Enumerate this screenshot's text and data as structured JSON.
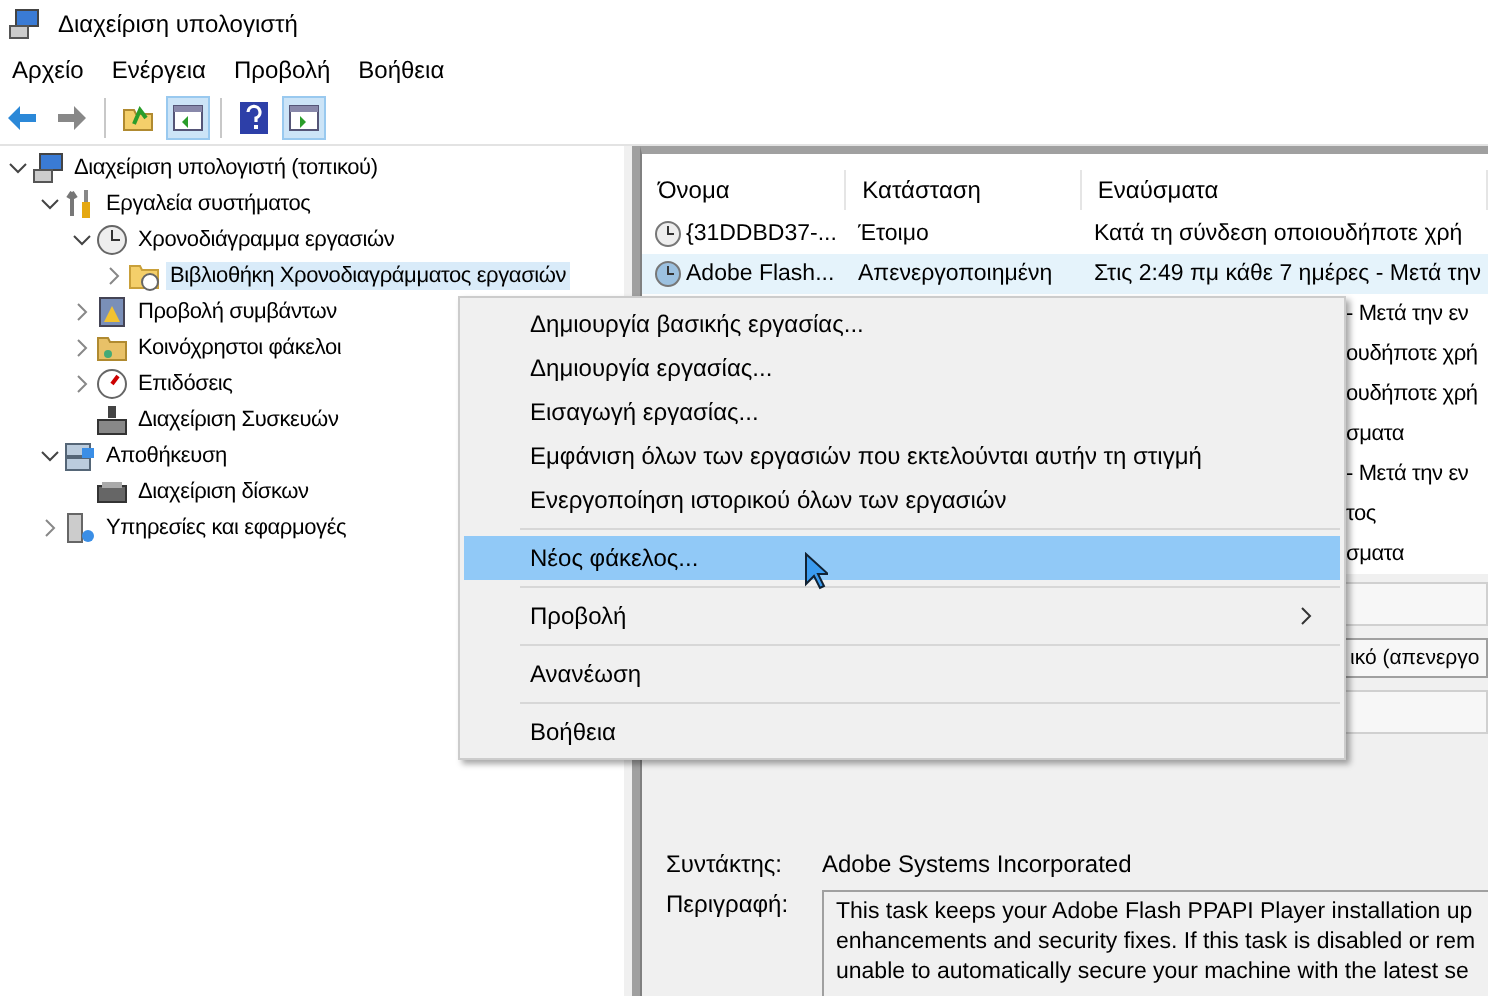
{
  "window": {
    "title": "Διαχείριση υπολογιστή"
  },
  "menu_bar": [
    "Αρχείο",
    "Ενέργεια",
    "Προβολή",
    "Βοήθεια"
  ],
  "toolbar": [
    {
      "kind": "back",
      "pressed": false
    },
    {
      "kind": "forward",
      "pressed": false
    },
    {
      "kind": "separator"
    },
    {
      "kind": "up",
      "pressed": false
    },
    {
      "kind": "tree",
      "pressed": true
    },
    {
      "kind": "separator"
    },
    {
      "kind": "help",
      "pressed": false
    },
    {
      "kind": "pane",
      "pressed": true
    }
  ],
  "tree": [
    {
      "label": "Διαχείριση υπολογιστή (τοπικού)",
      "kind": "computer",
      "expanded": true,
      "selected": false,
      "children": [
        {
          "label": "Εργαλεία συστήματος",
          "kind": "tools",
          "expanded": true,
          "selected": false,
          "children": [
            {
              "label": "Χρονοδιάγραμμα εργασιών",
              "kind": "clock",
              "expanded": true,
              "selected": false,
              "children": [
                {
                  "label": "Βιβλιοθήκη Χρονοδιαγράμματος εργασιών",
                  "kind": "folder",
                  "expanded": false,
                  "selected": true
                }
              ]
            },
            {
              "label": "Προβολή συμβάντων",
              "kind": "log",
              "expanded": false,
              "selected": false
            },
            {
              "label": "Κοινόχρηστοι φάκελοι",
              "kind": "share",
              "expanded": false,
              "selected": false
            },
            {
              "label": "Επιδόσεις",
              "kind": "gauge",
              "expanded": false,
              "selected": false
            },
            {
              "label": "Διαχείριση Συσκευών",
              "kind": "device",
              "selected": false
            }
          ]
        },
        {
          "label": "Αποθήκευση",
          "kind": "storage",
          "expanded": true,
          "selected": false,
          "children": [
            {
              "label": "Διαχείριση δίσκων",
              "kind": "disk",
              "selected": false
            }
          ]
        },
        {
          "label": "Υπηρεσίες και εφαρμογές",
          "kind": "services",
          "expanded": false,
          "selected": false
        }
      ]
    }
  ],
  "table": {
    "columns": [
      "Όνομα",
      "Κατάσταση",
      "Εναύσματα"
    ],
    "rows": [
      {
        "kind": "full",
        "cells": [
          "{31DDBD37-...",
          "Έτοιμο",
          "Κατά τη σύνδεση οποιουδήποτε χρή"
        ],
        "selected": false
      },
      {
        "kind": "full",
        "cells": [
          "Adobe Flash...",
          "Απενεργοποιημένη",
          "Στις 2:49 πμ κάθε 7 ημέρες - Μετά την"
        ],
        "selected": true
      },
      {
        "kind": "partial",
        "cells": [
          "- Μετά την εν"
        ],
        "selected": false
      },
      {
        "kind": "partial",
        "cells": [
          "ουδήποτε χρή"
        ],
        "selected": false
      },
      {
        "kind": "partial",
        "cells": [
          "ουδήποτε χρή"
        ],
        "selected": false
      },
      {
        "kind": "partial",
        "cells": [
          "σματα"
        ],
        "selected": false
      },
      {
        "kind": "partial",
        "cells": [
          "- Μετά την εν"
        ],
        "selected": false
      },
      {
        "kind": "partial",
        "cells": [
          "τος"
        ],
        "selected": false
      },
      {
        "kind": "partial",
        "cells": [
          "σματα"
        ],
        "selected": false
      }
    ]
  },
  "details": {
    "field_value": "ικό (απενεργο",
    "author_label": "Συντάκτης:",
    "author": "Adobe Systems Incorporated",
    "description_label": "Περιγραφή:",
    "description": "This task keeps your Adobe Flash PPAPI Player installation up\nenhancements and security fixes. If this task is disabled or rem\nunable to automatically secure your machine with the latest se"
  },
  "context_menu": [
    {
      "kind": "item",
      "label": "Δημιουργία βασικής εργασίας...",
      "selected": false,
      "submenu": false
    },
    {
      "kind": "item",
      "label": "Δημιουργία εργασίας...",
      "selected": false,
      "submenu": false
    },
    {
      "kind": "item",
      "label": "Εισαγωγή εργασίας...",
      "selected": false,
      "submenu": false
    },
    {
      "kind": "item",
      "label": "Εμφάνιση όλων των εργασιών που εκτελούνται αυτήν τη στιγμή",
      "selected": false,
      "submenu": false
    },
    {
      "kind": "item",
      "label": "Ενεργοποίηση ιστορικού όλων των εργασιών",
      "selected": false,
      "submenu": false
    },
    {
      "kind": "separator"
    },
    {
      "kind": "item",
      "label": "Νέος φάκελος...",
      "selected": true,
      "submenu": false
    },
    {
      "kind": "separator"
    },
    {
      "kind": "item",
      "label": "Προβολή",
      "selected": false,
      "submenu": true
    },
    {
      "kind": "separator"
    },
    {
      "kind": "item",
      "label": "Ανανέωση",
      "selected": false,
      "submenu": false
    },
    {
      "kind": "separator"
    },
    {
      "kind": "item",
      "label": "Βοήθεια",
      "selected": false,
      "submenu": false
    }
  ]
}
